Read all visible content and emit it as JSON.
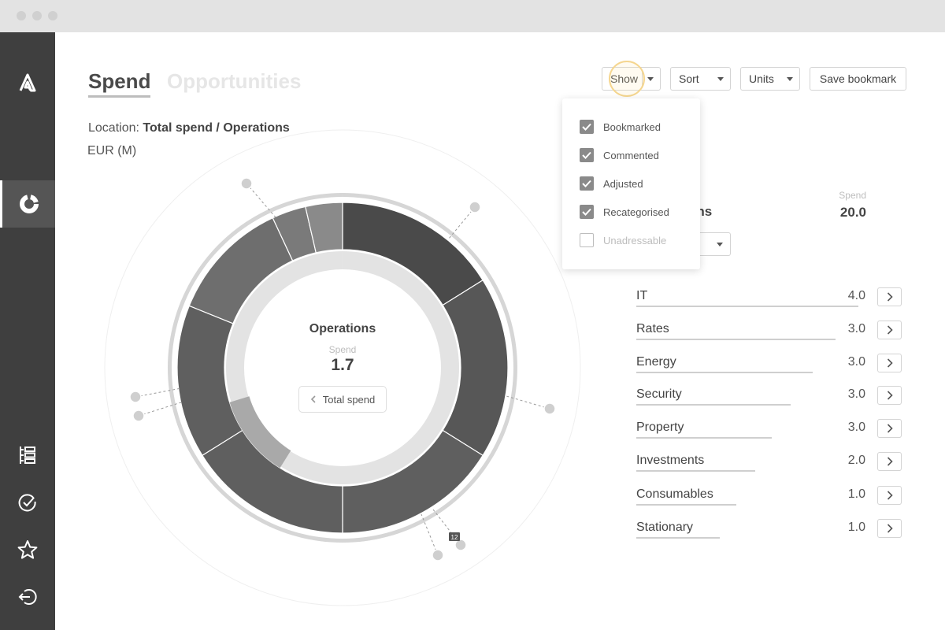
{
  "tabs": {
    "active": "Spend",
    "inactive": "Opportunities"
  },
  "location": {
    "label": "Location:",
    "path": "Total spend / Operations"
  },
  "units_label": "EUR (M)",
  "toolbar": {
    "show": "Show",
    "sort": "Sort",
    "units": "Units",
    "save": "Save bookmark"
  },
  "show_menu": [
    {
      "label": "Bookmarked",
      "checked": true
    },
    {
      "label": "Commented",
      "checked": true
    },
    {
      "label": "Adjusted",
      "checked": true
    },
    {
      "label": "Recategorised",
      "checked": true
    },
    {
      "label": "Unadressable",
      "checked": false
    }
  ],
  "summary": {
    "title_partial": "ons",
    "spend_label": "Spend",
    "spend_value": "20.0"
  },
  "center": {
    "title": "Operations",
    "spend_label": "Spend",
    "value": "1.7",
    "back_label": "Total spend"
  },
  "categories": [
    {
      "name": "IT",
      "value": "4.0"
    },
    {
      "name": "Rates",
      "value": "3.0"
    },
    {
      "name": "Energy",
      "value": "3.0"
    },
    {
      "name": "Security",
      "value": "3.0"
    },
    {
      "name": "Property",
      "value": "3.0"
    },
    {
      "name": "Investments",
      "value": "2.0"
    },
    {
      "name": "Consumables",
      "value": "1.0"
    },
    {
      "name": "Stationary",
      "value": "1.0"
    }
  ],
  "comment_badge": "12",
  "colors": {
    "sidebar": "#3f3f3f",
    "accent_highlight": "#f5d68f",
    "segment_dark": "#4a4a4a",
    "segment_mid": "#5f5f5f",
    "segment_light": "#8a8a8a"
  },
  "icons": {
    "logo": "a-logo-icon",
    "nav": [
      "donut-chart-icon",
      "tree-list-icon",
      "check-circle-icon",
      "star-icon",
      "logout-icon"
    ]
  }
}
